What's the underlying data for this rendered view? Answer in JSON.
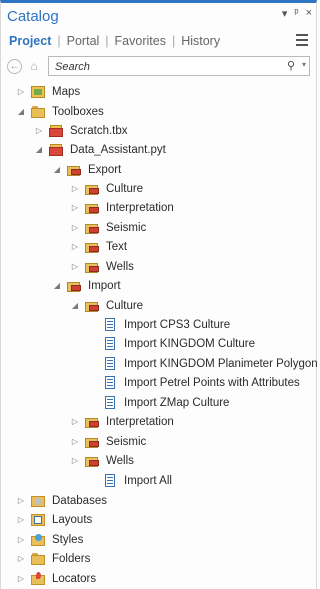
{
  "window": {
    "title": "Catalog",
    "pin_glyph": "▾ ᵖ ×"
  },
  "tabs": [
    {
      "label": "Project",
      "active": true
    },
    {
      "label": "Portal",
      "active": false
    },
    {
      "label": "Favorites",
      "active": false
    },
    {
      "label": "History",
      "active": false
    }
  ],
  "search": {
    "placeholder": "Search"
  },
  "tree": [
    {
      "label": "Maps",
      "icon": "map",
      "state": "collapsed"
    },
    {
      "label": "Toolboxes",
      "icon": "folder",
      "state": "expanded"
    },
    {
      "label": "Scratch.tbx",
      "icon": "toolbox",
      "state": "collapsed"
    },
    {
      "label": "Data_Assistant.pyt",
      "icon": "toolbox",
      "state": "expanded"
    },
    {
      "label": "Export",
      "icon": "toolset",
      "state": "expanded"
    },
    {
      "label": "Culture",
      "icon": "toolset",
      "state": "collapsed"
    },
    {
      "label": "Interpretation",
      "icon": "toolset",
      "state": "collapsed"
    },
    {
      "label": "Seismic",
      "icon": "toolset",
      "state": "collapsed"
    },
    {
      "label": "Text",
      "icon": "toolset",
      "state": "collapsed"
    },
    {
      "label": "Wells",
      "icon": "toolset",
      "state": "collapsed"
    },
    {
      "label": "Import",
      "icon": "toolset",
      "state": "expanded"
    },
    {
      "label": "Culture",
      "icon": "toolset",
      "state": "expanded"
    },
    {
      "label": "Import CPS3 Culture",
      "icon": "script",
      "state": "leaf"
    },
    {
      "label": "Import KINGDOM Culture",
      "icon": "script",
      "state": "leaf"
    },
    {
      "label": "Import KINGDOM Planimeter Polygon",
      "icon": "script",
      "state": "leaf"
    },
    {
      "label": "Import Petrel Points with Attributes",
      "icon": "script",
      "state": "leaf"
    },
    {
      "label": "Import ZMap Culture",
      "icon": "script",
      "state": "leaf"
    },
    {
      "label": "Interpretation",
      "icon": "toolset",
      "state": "collapsed"
    },
    {
      "label": "Seismic",
      "icon": "toolset",
      "state": "collapsed"
    },
    {
      "label": "Wells",
      "icon": "toolset",
      "state": "collapsed"
    },
    {
      "label": "Import All",
      "icon": "script",
      "state": "leaf"
    },
    {
      "label": "Databases",
      "icon": "database",
      "state": "collapsed"
    },
    {
      "label": "Layouts",
      "icon": "layout",
      "state": "collapsed"
    },
    {
      "label": "Styles",
      "icon": "styles",
      "state": "collapsed"
    },
    {
      "label": "Folders",
      "icon": "folder",
      "state": "collapsed"
    },
    {
      "label": "Locators",
      "icon": "locator",
      "state": "collapsed"
    }
  ]
}
